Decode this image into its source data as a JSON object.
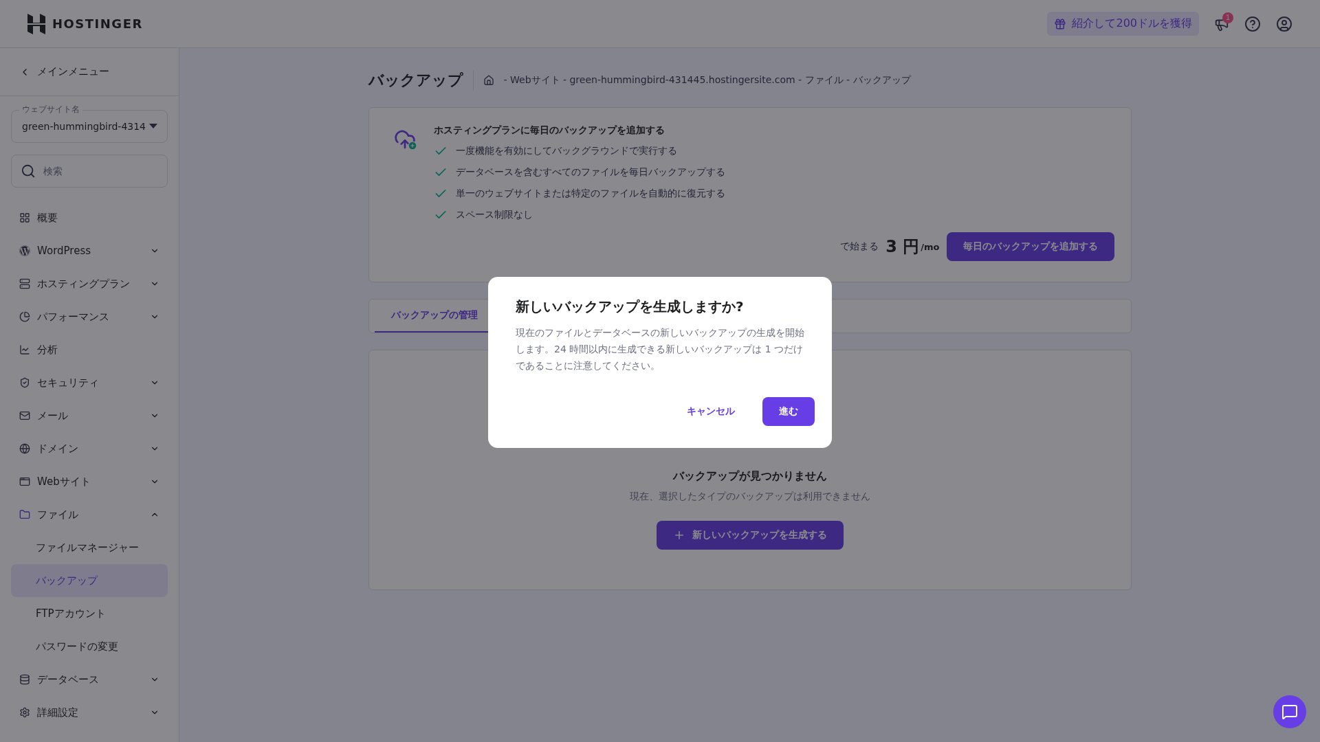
{
  "header": {
    "logo": "HOSTINGER",
    "referral": "紹介して200ドルを獲得",
    "notification_count": "1"
  },
  "sidebar": {
    "back": "メインメニュー",
    "website_select": {
      "label": "ウェブサイト名",
      "value": "green-hummingbird-4314"
    },
    "search": {
      "placeholder": "検索"
    },
    "items": [
      {
        "label": "概要",
        "kind": "link"
      },
      {
        "label": "WordPress",
        "kind": "group",
        "expanded": false
      },
      {
        "label": "ホスティングプラン",
        "kind": "group",
        "expanded": false
      },
      {
        "label": "パフォーマンス",
        "kind": "group",
        "expanded": false
      },
      {
        "label": "分析",
        "kind": "link"
      },
      {
        "label": "セキュリティ",
        "kind": "group",
        "expanded": false
      },
      {
        "label": "メール",
        "kind": "group",
        "expanded": false
      },
      {
        "label": "ドメイン",
        "kind": "group",
        "expanded": false
      },
      {
        "label": "Webサイト",
        "kind": "group",
        "expanded": false
      },
      {
        "label": "ファイル",
        "kind": "group",
        "expanded": true,
        "children": [
          {
            "label": "ファイルマネージャー",
            "selected": false
          },
          {
            "label": "バックアップ",
            "selected": true
          },
          {
            "label": "FTPアカウント",
            "selected": false
          },
          {
            "label": "パスワードの変更",
            "selected": false
          }
        ]
      },
      {
        "label": "データベース",
        "kind": "group",
        "expanded": false
      },
      {
        "label": "詳細設定",
        "kind": "group",
        "expanded": false
      }
    ]
  },
  "page": {
    "title": "バックアップ",
    "breadcrumb": "- Webサイト - green-hummingbird-431445.hostingersite.com - ファイル - バックアップ"
  },
  "promo": {
    "title": "ホスティングプランに毎日のバックアップを追加する",
    "features": [
      "一度機能を有効にしてバックグラウンドで実行する",
      "データベースを含むすべてのファイルを毎日バックアップする",
      "単一のウェブサイトまたは特定のファイルを自動的に復元する",
      "スペース制限なし"
    ],
    "price_prefix": "で始まる",
    "price": "3 円",
    "price_unit": "/mo",
    "button": "毎日のバックアップを追加する"
  },
  "tabs": [
    {
      "label": "バックアップの管理",
      "selected": true
    }
  ],
  "empty_state": {
    "title": "バックアップが見つかりません",
    "text": "現在、選択したタイプのバックアップは利用できません",
    "button": "新しいバックアップを生成する"
  },
  "dialog": {
    "title": "新しいバックアップを生成しますか?",
    "body": "現在のファイルとデータベースの新しいバックアップの生成を開始します。24 時間以内に生成できる新しいバックアップは 1 つだけであることに注意してください。",
    "cancel": "キャンセル",
    "confirm": "進む"
  }
}
